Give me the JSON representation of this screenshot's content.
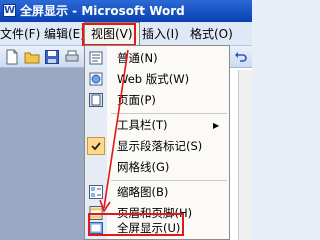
{
  "window": {
    "title": "全屏显示 - Microsoft Word",
    "icon": "word-doc-icon"
  },
  "menubar": {
    "items": [
      {
        "label": "文件(F)"
      },
      {
        "label": "编辑(E)"
      },
      {
        "label": "视图(V)"
      },
      {
        "label": "插入(I)"
      },
      {
        "label": "格式(O)"
      }
    ]
  },
  "toolbar": {
    "icons": [
      "new-doc-icon",
      "open-folder-icon",
      "save-icon"
    ]
  },
  "view_menu": {
    "items": [
      {
        "label": "普通(N)",
        "icon": "normal-view-icon"
      },
      {
        "label": "Web 版式(W)",
        "icon": "web-layout-icon"
      },
      {
        "label": "页面(P)",
        "icon": "page-layout-icon"
      },
      {
        "label": "工具栏(T)",
        "submenu": true
      },
      {
        "label": "显示段落标记(S)",
        "checked": true
      },
      {
        "label": "网格线(G)"
      },
      {
        "label": "缩略图(B)",
        "icon": "thumbnail-icon"
      },
      {
        "label": "页眉和页脚(H)",
        "icon": "header-footer-icon"
      },
      {
        "label": "全屏显示(U)",
        "icon": "fullscreen-icon"
      }
    ]
  },
  "colors": {
    "highlight_red": "#e01818",
    "titlebar_blue": "#0a3fb1"
  }
}
